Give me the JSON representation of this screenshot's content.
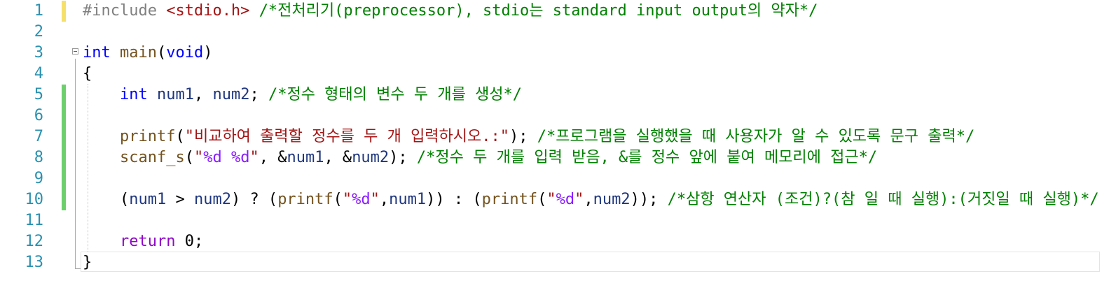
{
  "editor": {
    "lines": [
      {
        "number": "1",
        "status": "unsaved",
        "tokens": [
          {
            "type": "pp",
            "text": "#include "
          },
          {
            "type": "inc",
            "text": "<stdio.h>"
          },
          {
            "type": "pl",
            "text": " "
          },
          {
            "type": "cm",
            "text": "/*전처리기(preprocessor), stdio는 standard input output의 약자*/"
          }
        ]
      },
      {
        "number": "2",
        "status": "none",
        "tokens": []
      },
      {
        "number": "3",
        "status": "none",
        "fold": true,
        "tokens": [
          {
            "type": "kw",
            "text": "int"
          },
          {
            "type": "pl",
            "text": " "
          },
          {
            "type": "fn",
            "text": "main"
          },
          {
            "type": "pl",
            "text": "("
          },
          {
            "type": "kw",
            "text": "void"
          },
          {
            "type": "pl",
            "text": ")"
          }
        ]
      },
      {
        "number": "4",
        "status": "none",
        "tokens": [
          {
            "type": "pl",
            "text": "{"
          }
        ]
      },
      {
        "number": "5",
        "status": "saved",
        "tokens": [
          {
            "type": "pl",
            "text": "    "
          },
          {
            "type": "kw",
            "text": "int"
          },
          {
            "type": "pl",
            "text": " "
          },
          {
            "type": "var",
            "text": "num1"
          },
          {
            "type": "pl",
            "text": ", "
          },
          {
            "type": "var",
            "text": "num2"
          },
          {
            "type": "pl",
            "text": "; "
          },
          {
            "type": "cm",
            "text": "/*정수 형태의 변수 두 개를 생성*/"
          }
        ]
      },
      {
        "number": "6",
        "status": "saved",
        "tokens": []
      },
      {
        "number": "7",
        "status": "saved",
        "tokens": [
          {
            "type": "pl",
            "text": "    "
          },
          {
            "type": "fn",
            "text": "printf"
          },
          {
            "type": "pl",
            "text": "("
          },
          {
            "type": "str",
            "text": "\"비교하여 출력할 정수를 두 개 입력하시오.:\""
          },
          {
            "type": "pl",
            "text": "); "
          },
          {
            "type": "cm",
            "text": "/*프로그램을 실행했을 때 사용자가 알 수 있도록 문구 출력*/"
          }
        ]
      },
      {
        "number": "8",
        "status": "saved",
        "tokens": [
          {
            "type": "pl",
            "text": "    "
          },
          {
            "type": "fn",
            "text": "scanf_s"
          },
          {
            "type": "pl",
            "text": "("
          },
          {
            "type": "str",
            "text": "\""
          },
          {
            "type": "fmt",
            "text": "%d"
          },
          {
            "type": "str",
            "text": " "
          },
          {
            "type": "fmt",
            "text": "%d"
          },
          {
            "type": "str",
            "text": "\""
          },
          {
            "type": "pl",
            "text": ", &"
          },
          {
            "type": "var",
            "text": "num1"
          },
          {
            "type": "pl",
            "text": ", &"
          },
          {
            "type": "var",
            "text": "num2"
          },
          {
            "type": "pl",
            "text": "); "
          },
          {
            "type": "cm",
            "text": "/*정수 두 개를 입력 받음, &를 정수 앞에 붙여 메모리에 접근*/"
          }
        ]
      },
      {
        "number": "9",
        "status": "saved",
        "tokens": []
      },
      {
        "number": "10",
        "status": "saved",
        "tokens": [
          {
            "type": "pl",
            "text": "    ("
          },
          {
            "type": "var",
            "text": "num1"
          },
          {
            "type": "pl",
            "text": " > "
          },
          {
            "type": "var",
            "text": "num2"
          },
          {
            "type": "pl",
            "text": ") ? ("
          },
          {
            "type": "fn",
            "text": "printf"
          },
          {
            "type": "pl",
            "text": "("
          },
          {
            "type": "str",
            "text": "\""
          },
          {
            "type": "fmt",
            "text": "%d"
          },
          {
            "type": "str",
            "text": "\""
          },
          {
            "type": "pl",
            "text": ","
          },
          {
            "type": "var",
            "text": "num1"
          },
          {
            "type": "pl",
            "text": ")) : ("
          },
          {
            "type": "fn",
            "text": "printf"
          },
          {
            "type": "pl",
            "text": "("
          },
          {
            "type": "str",
            "text": "\""
          },
          {
            "type": "fmt",
            "text": "%d"
          },
          {
            "type": "str",
            "text": "\""
          },
          {
            "type": "pl",
            "text": ","
          },
          {
            "type": "var",
            "text": "num2"
          },
          {
            "type": "pl",
            "text": ")); "
          },
          {
            "type": "cm",
            "text": "/*삼항 연산자 (조건)?(참 일 때 실행):(거짓일 때 실행)*/"
          }
        ]
      },
      {
        "number": "11",
        "status": "none",
        "tokens": []
      },
      {
        "number": "12",
        "status": "none",
        "tokens": [
          {
            "type": "pl",
            "text": "    "
          },
          {
            "type": "ctl",
            "text": "return"
          },
          {
            "type": "pl",
            "text": " "
          },
          {
            "type": "num",
            "text": "0"
          },
          {
            "type": "pl",
            "text": ";"
          }
        ]
      },
      {
        "number": "13",
        "status": "none",
        "tokens": [
          {
            "type": "pl",
            "text": "}"
          }
        ]
      }
    ]
  },
  "colors": {
    "line_number": "#2b91af",
    "keyword": "#0000ff",
    "control_keyword": "#8f08c4",
    "function": "#74531f",
    "variable": "#1f377f",
    "string": "#a31515",
    "format_specifier": "#8a1bff",
    "comment": "#008000",
    "preprocessor": "#808080",
    "saved_change": "#6ccf6c",
    "unsaved_change": "#f5e06a"
  }
}
